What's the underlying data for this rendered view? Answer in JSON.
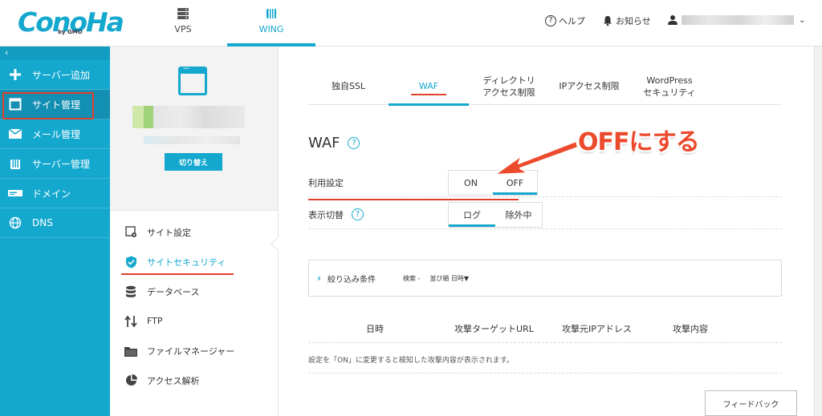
{
  "header": {
    "logo": "ConoHa",
    "logo_sub": "by GMO",
    "tabs": [
      {
        "label": "VPS",
        "icon": "server-icon"
      },
      {
        "label": "WING",
        "icon": "wing-icon",
        "active": true
      }
    ],
    "help": "ヘルプ",
    "notice": "お知らせ"
  },
  "sidebar": {
    "collapse": "‹",
    "items": [
      {
        "label": "サーバー追加",
        "icon": "plus-icon"
      },
      {
        "label": "サイト管理",
        "icon": "site-icon",
        "active": true
      },
      {
        "label": "メール管理",
        "icon": "mail-icon"
      },
      {
        "label": "サーバー管理",
        "icon": "server-manage-icon"
      },
      {
        "label": "ドメイン",
        "icon": "domain-icon"
      },
      {
        "label": "DNS",
        "icon": "globe-icon"
      }
    ]
  },
  "site_panel": {
    "switch_button": "切り替え",
    "menu": [
      {
        "label": "サイト設定",
        "icon": "settings-icon"
      },
      {
        "label": "サイトセキュリティ",
        "icon": "shield-icon",
        "active": true
      },
      {
        "label": "データベース",
        "icon": "database-icon"
      },
      {
        "label": "FTP",
        "icon": "transfer-icon"
      },
      {
        "label": "ファイルマネージャー",
        "icon": "folder-icon"
      },
      {
        "label": "アクセス解析",
        "icon": "pie-chart-icon"
      }
    ]
  },
  "main": {
    "tabs": [
      {
        "label": "独自SSL"
      },
      {
        "label": "WAF",
        "active": true
      },
      {
        "label": "ディレクトリ\nアクセス制限"
      },
      {
        "label": "IPアクセス制限"
      },
      {
        "label": "WordPress\nセキュリティ"
      }
    ],
    "title": "WAF",
    "usage_label": "利用設定",
    "usage_on": "ON",
    "usage_off": "OFF",
    "display_label": "表示切替",
    "display_log": "ログ",
    "display_exclude": "除外中",
    "filter": {
      "title": "絞り込み条件",
      "search": "検索 -",
      "order": "並び順  日時▼"
    },
    "table_headers": [
      "日時",
      "攻撃ターゲットURL",
      "攻撃元IPアドレス",
      "攻撃内容"
    ],
    "empty_message": "設定を「ON」に変更すると検知した攻撃内容が表示されます。",
    "feedback": "フィードバック"
  },
  "annotation": {
    "text": "OFFにする",
    "color": "#ec4a2c"
  },
  "colors": {
    "brand": "#15a8cf",
    "highlight": "#e2402b"
  }
}
